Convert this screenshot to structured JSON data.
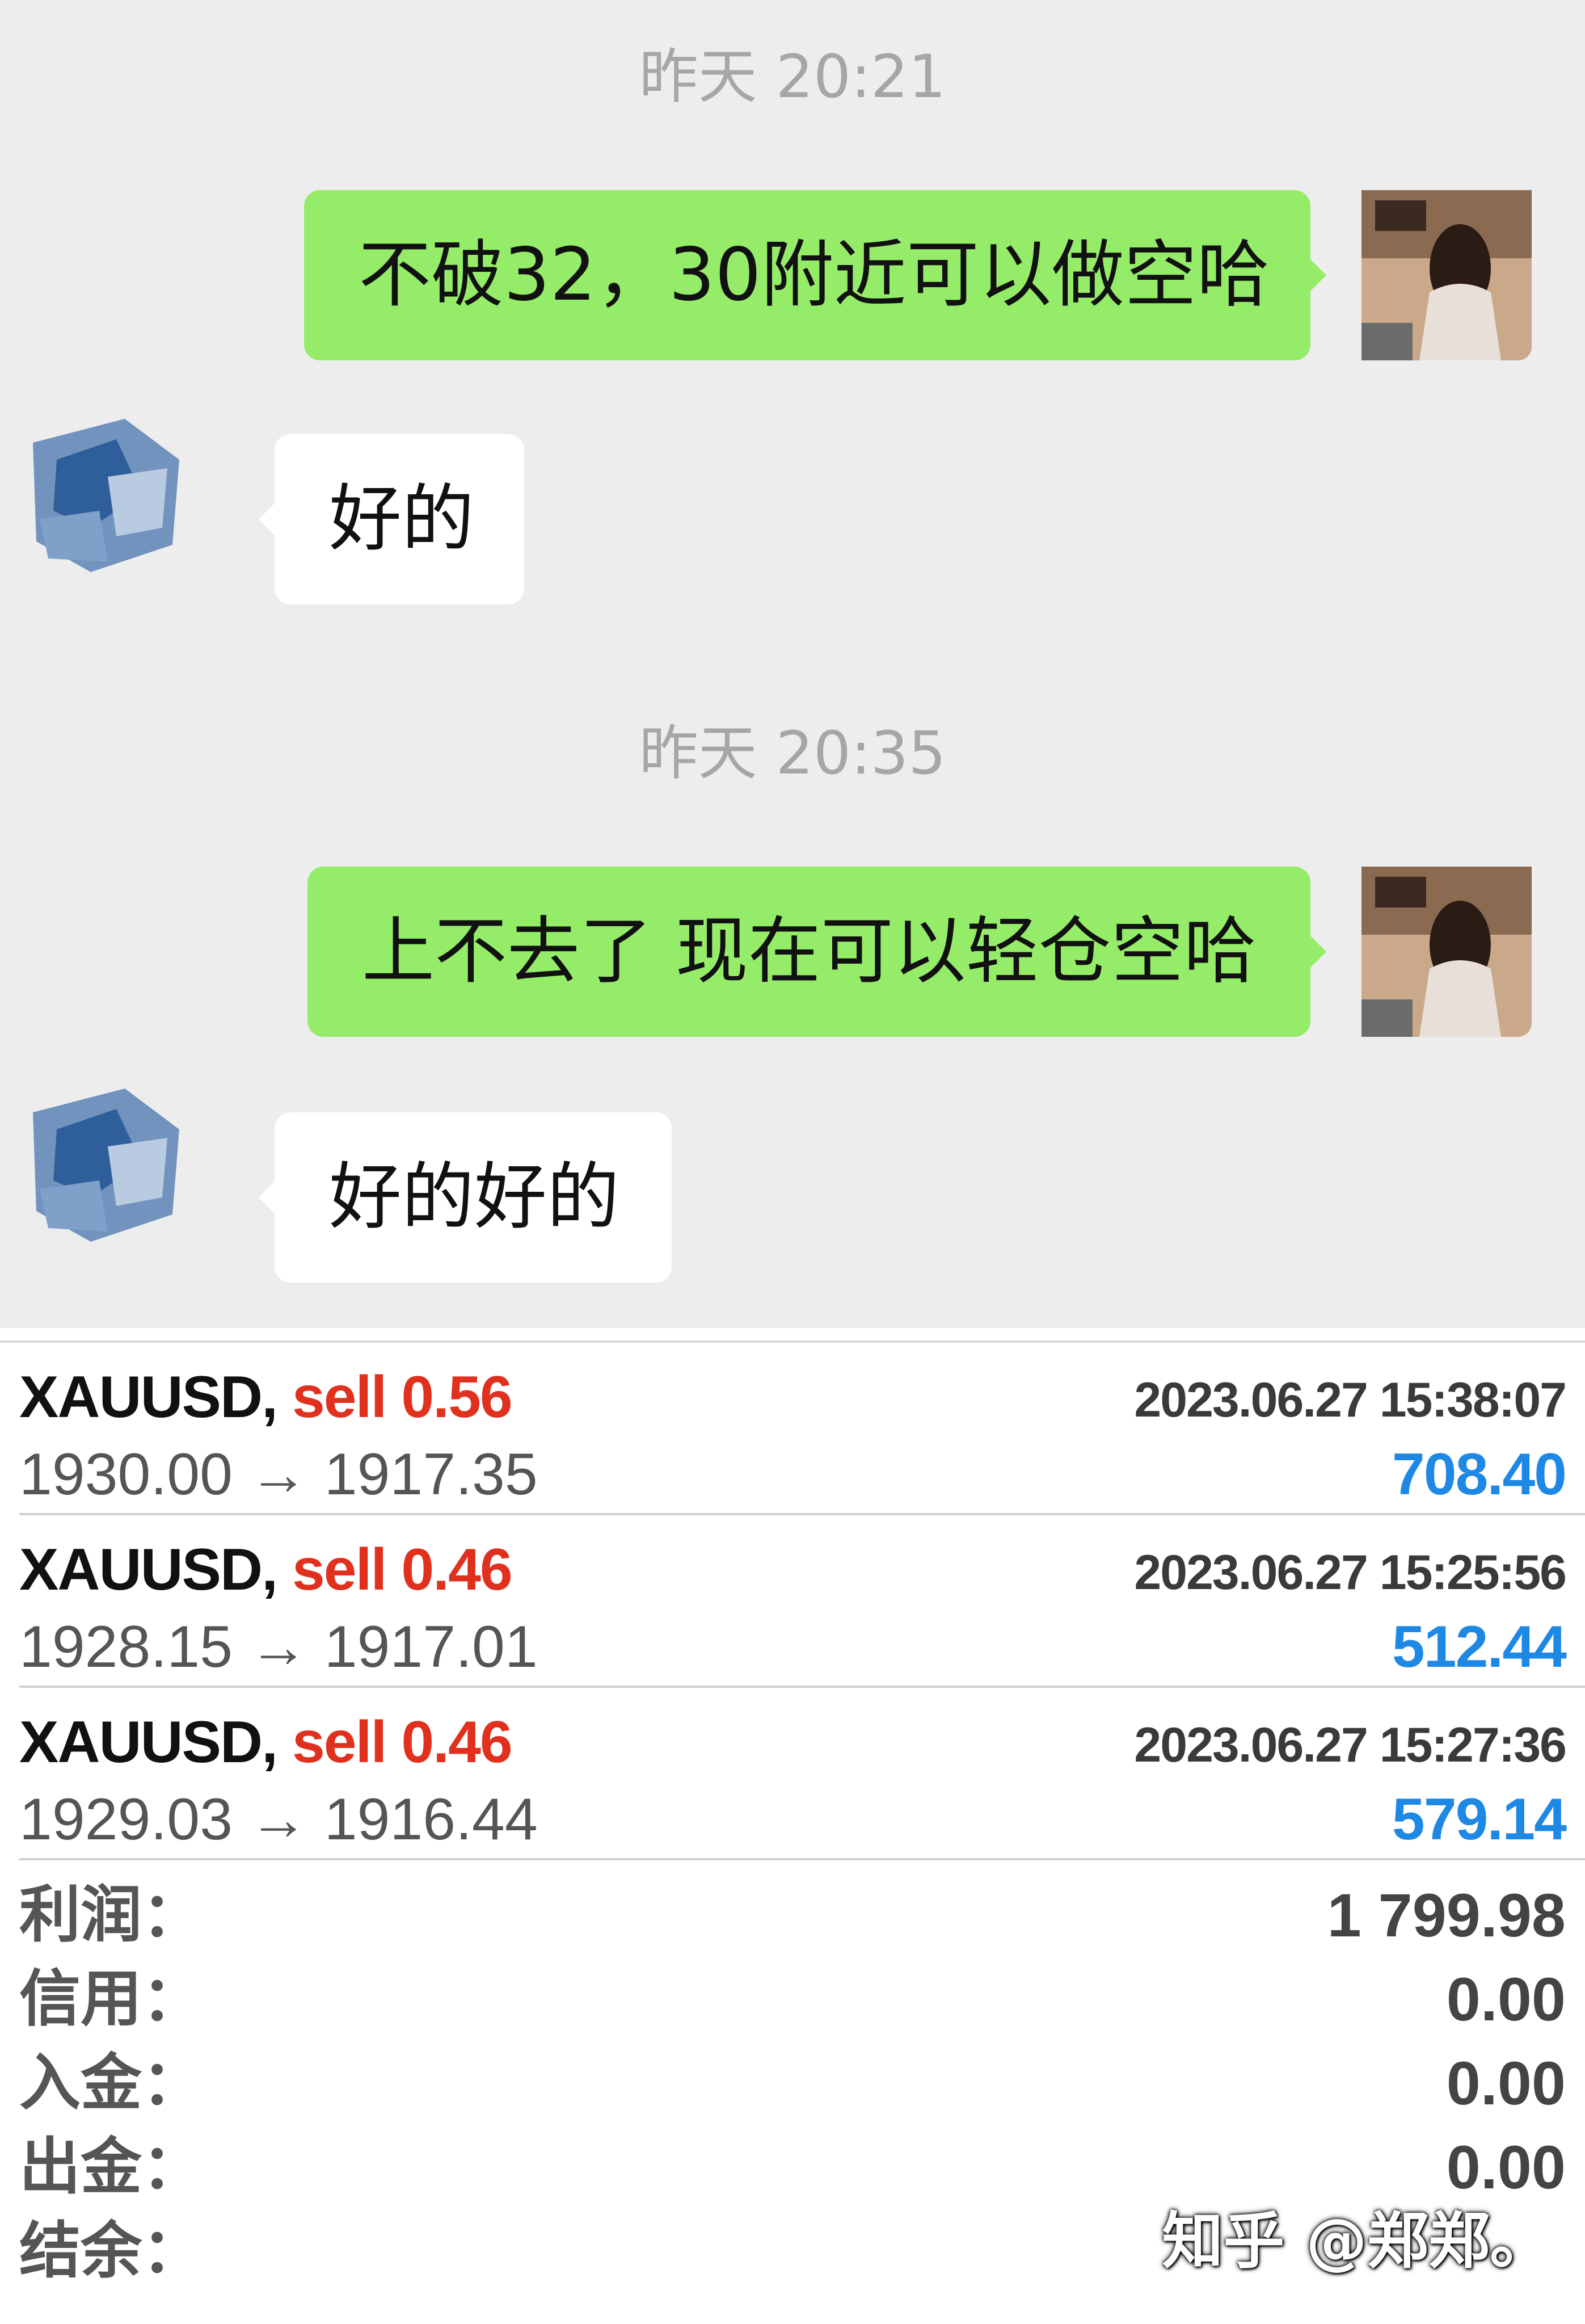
{
  "chat": {
    "messages": [
      {
        "timestamp": "昨天 20:21",
        "outgoing": "不破32，30附近可以做空哈",
        "reply": "好的"
      },
      {
        "timestamp": "昨天 20:35",
        "outgoing": "上不去了 现在可以轻仓空哈",
        "reply": "好的好的"
      }
    ]
  },
  "trades": [
    {
      "symbol": "XAUUSD,",
      "side": "sell 0.56",
      "time": "2023.06.27 15:38:07",
      "prices": "1930.00 → 1917.35",
      "profit": "708.40"
    },
    {
      "symbol": "XAUUSD,",
      "side": "sell 0.46",
      "time": "2023.06.27 15:25:56",
      "prices": "1928.15 → 1917.01",
      "profit": "512.44"
    },
    {
      "symbol": "XAUUSD,",
      "side": "sell 0.46",
      "time": "2023.06.27 15:27:36",
      "prices": "1929.03 → 1916.44",
      "profit": "579.14"
    }
  ],
  "summary": [
    {
      "label": "利润：",
      "value": "1 799.98"
    },
    {
      "label": "信用：",
      "value": "0.00"
    },
    {
      "label": "入金：",
      "value": "0.00"
    },
    {
      "label": "出金：",
      "value": "0.00"
    },
    {
      "label": "结余：",
      "value": ""
    }
  ],
  "watermark": "知乎 @郑郑。",
  "colors": {
    "outgoing_bubble": "#95ec69",
    "sell": "#e0301e",
    "profit": "#1e88e5",
    "chat_bg": "#ededed"
  }
}
